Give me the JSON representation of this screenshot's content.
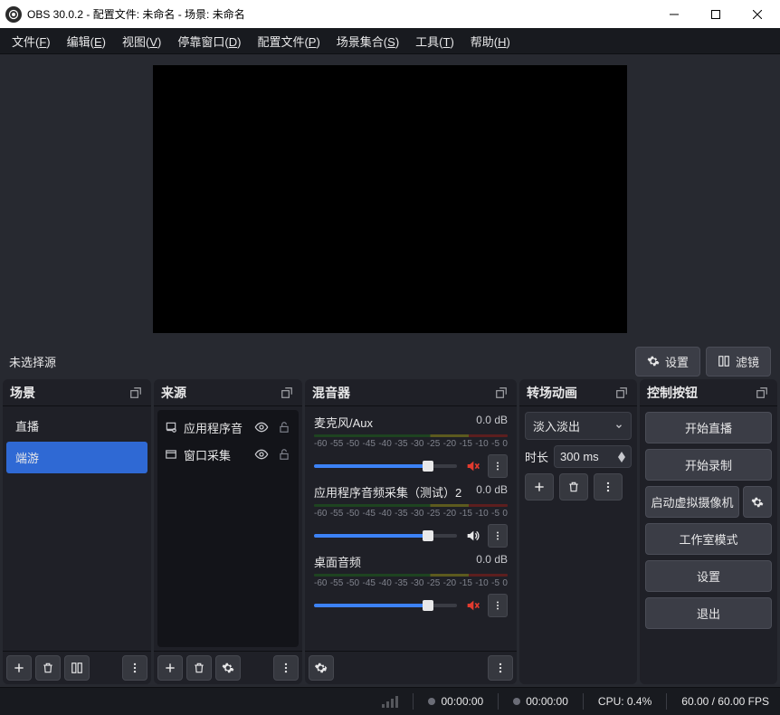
{
  "title": "OBS 30.0.2 - 配置文件: 未命名 - 场景: 未命名",
  "menu": {
    "file": {
      "label": "文件",
      "mnemonic": "F"
    },
    "edit": {
      "label": "编辑",
      "mnemonic": "E"
    },
    "view": {
      "label": "视图",
      "mnemonic": "V"
    },
    "docks": {
      "label": "停靠窗口",
      "mnemonic": "D"
    },
    "profile": {
      "label": "配置文件",
      "mnemonic": "P"
    },
    "scene_collection": {
      "label": "场景集合",
      "mnemonic": "S"
    },
    "tools": {
      "label": "工具",
      "mnemonic": "T"
    },
    "help": {
      "label": "帮助",
      "mnemonic": "H"
    }
  },
  "source_toolbar": {
    "no_source": "未选择源",
    "settings": "设置",
    "filters": "滤镜"
  },
  "docks": {
    "scenes": {
      "title": "场景"
    },
    "sources": {
      "title": "来源"
    },
    "mixer": {
      "title": "混音器"
    },
    "transitions": {
      "title": "转场动画"
    },
    "controls": {
      "title": "控制按钮"
    }
  },
  "scenes": [
    {
      "name": "直播",
      "selected": false
    },
    {
      "name": "端游",
      "selected": true
    }
  ],
  "sources": [
    {
      "name": "应用程序音",
      "type": "app-audio",
      "visible": true
    },
    {
      "name": "窗口采集",
      "type": "window-capture",
      "visible": true
    }
  ],
  "vu_ticks": [
    "-60",
    "-55",
    "-50",
    "-45",
    "-40",
    "-35",
    "-30",
    "-25",
    "-20",
    "-15",
    "-10",
    "-5",
    "0"
  ],
  "mixer": [
    {
      "name": "麦克风/Aux",
      "db": "0.0 dB",
      "muted": true
    },
    {
      "name": "应用程序音频采集（测试）2",
      "db": "0.0 dB",
      "muted": false
    },
    {
      "name": "桌面音频",
      "db": "0.0 dB",
      "muted": true
    }
  ],
  "transitions": {
    "selected": "淡入淡出",
    "duration_label": "时长",
    "duration_value": "300 ms"
  },
  "controls": {
    "start_stream": "开始直播",
    "start_record": "开始录制",
    "start_vcam": "启动虚拟摄像机",
    "studio_mode": "工作室模式",
    "settings": "设置",
    "exit": "退出"
  },
  "status": {
    "live_time": "00:00:00",
    "rec_time": "00:00:00",
    "cpu": "CPU: 0.4%",
    "fps": "60.00 / 60.00 FPS"
  }
}
